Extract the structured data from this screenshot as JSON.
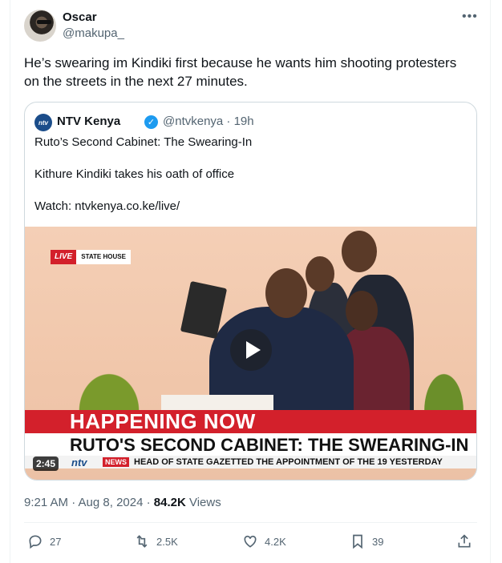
{
  "author": {
    "name": "Oscar",
    "handle": "@makupa_"
  },
  "tweet": {
    "text_line1": "He’s swearing im Kindiki first because he wants him shooting protesters",
    "text_line2": "on the streets in the next 27 minutes."
  },
  "quote": {
    "logo_text": "ntv",
    "name": "NTV Kenya",
    "handle_time": "@ntvkenya · 19h",
    "line1": "Ruto’s Second Cabinet: The Swearing-In",
    "line2": "Kithure Kindiki takes his oath of office",
    "line3": "Watch: ntvkenya.co.ke/live/",
    "video": {
      "live_label": "LIVE",
      "location_label": "STATE HOUSE",
      "headline": "HAPPENING NOW",
      "subheadline": "RUTO'S SECOND CABINET: THE SWEARING-IN",
      "ticker_brand": "ntv",
      "ticker_news": "NEWS",
      "ticker_text": "HEAD OF STATE GAZETTED THE APPOINTMENT OF THE 19 YESTERDAY",
      "duration": "2:45"
    }
  },
  "meta": {
    "timestamp": "9:21 AM · Aug 8, 2024 · ",
    "views_count": "84.2K",
    "views_label": " Views"
  },
  "actions": {
    "replies": "27",
    "reposts": "2.5K",
    "likes": "4.2K",
    "bookmarks": "39"
  },
  "colors": {
    "accent": "#1d9bf0",
    "ntv_red": "#d3202b",
    "ntv_blue": "#1b4d8a"
  }
}
